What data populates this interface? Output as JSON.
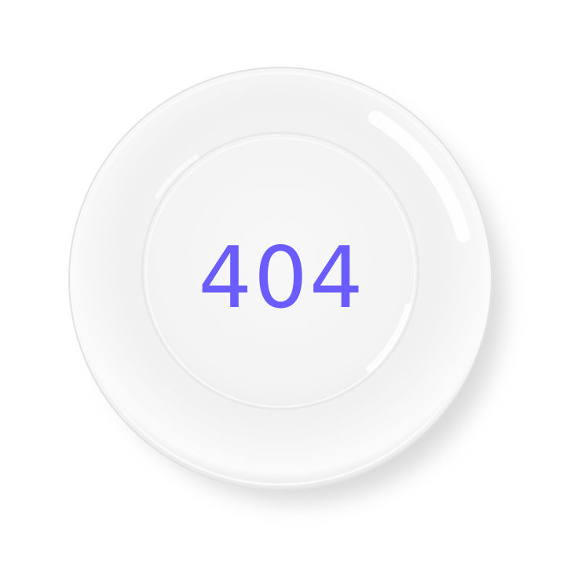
{
  "error": {
    "code": "404"
  },
  "colors": {
    "accent": "#6a5cff",
    "background": "#ffffff",
    "plate": "#f7f7f7"
  },
  "illustration": {
    "icon": "plate-icon"
  }
}
